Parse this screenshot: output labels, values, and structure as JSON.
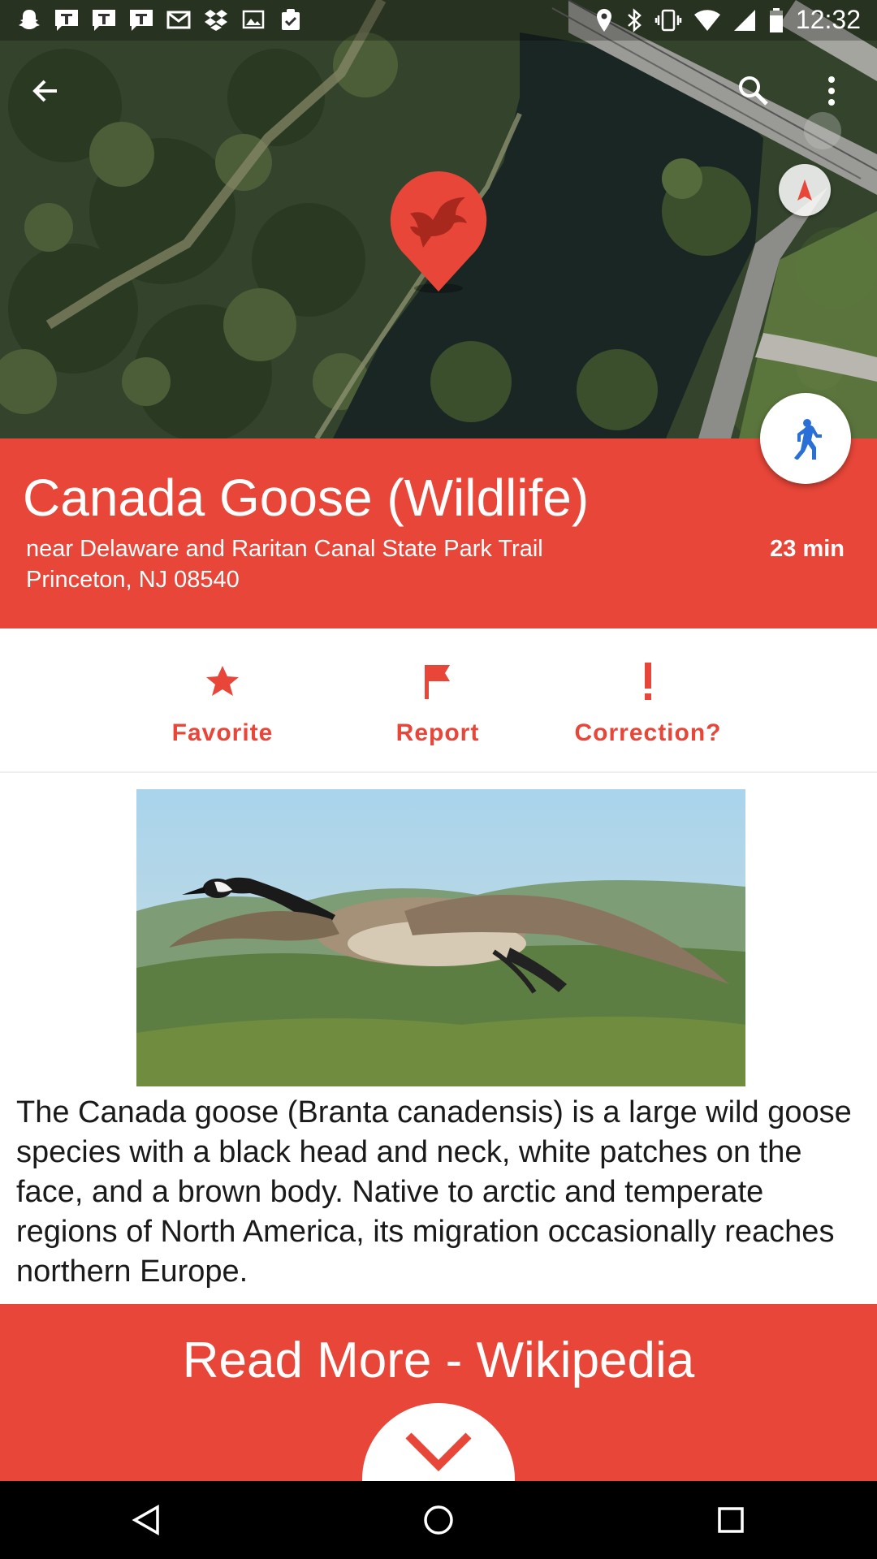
{
  "status_bar": {
    "time": "12:32",
    "notification_icons": [
      "snapchat-icon",
      "t-app-icon",
      "t-app-icon",
      "t-app-icon",
      "gmail-icon",
      "dropbox-icon",
      "gallery-icon",
      "clipboard-icon"
    ],
    "system_icons": [
      "location-icon",
      "bluetooth-icon",
      "vibrate-icon",
      "wifi-icon",
      "signal-icon",
      "battery-icon"
    ]
  },
  "map": {
    "marker_icon": "bird-icon",
    "marker_color": "#e84638"
  },
  "header": {
    "title": "Canada Goose (Wildlife)",
    "address_line1": "near Delaware and Raritan Canal State Park Trail",
    "address_line2": "Princeton, NJ 08540",
    "walk_time": "23 min",
    "background": "#e84638"
  },
  "actions": [
    {
      "label": "Favorite",
      "icon": "star-icon"
    },
    {
      "label": "Report",
      "icon": "flag-icon"
    },
    {
      "label": "Correction?",
      "icon": "exclamation-icon"
    }
  ],
  "content": {
    "description": "The Canada goose (Branta canadensis) is a large wild goose species with a black head and neck, white patches on the face, and a brown body. Native to arctic and temperate regions of North America, its migration occasionally reaches northern Europe."
  },
  "read_more": {
    "label": "Read More - Wikipedia"
  },
  "colors": {
    "accent": "#e84638",
    "fab_icon": "#2a6fd6"
  }
}
